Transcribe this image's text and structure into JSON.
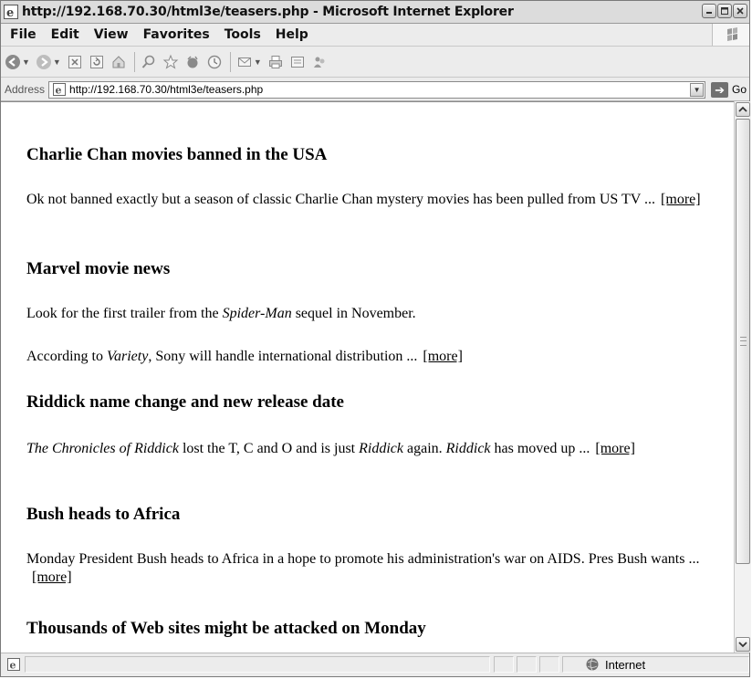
{
  "window": {
    "title": "http://192.168.70.30/html3e/teasers.php - Microsoft Internet Explorer"
  },
  "menubar": {
    "items": [
      "File",
      "Edit",
      "View",
      "Favorites",
      "Tools",
      "Help"
    ]
  },
  "toolbar": {
    "buttons": [
      "back-icon",
      "forward-icon",
      "stop-icon",
      "refresh-icon",
      "home-icon",
      "search-icon",
      "favorites-icon",
      "media-icon",
      "history-icon",
      "mail-icon",
      "print-icon",
      "edit-icon",
      "messenger-icon"
    ]
  },
  "addressbar": {
    "label": "Address",
    "url": "http://192.168.70.30/html3e/teasers.php",
    "go_label": "Go"
  },
  "articles": [
    {
      "headline": "Charlie Chan movies banned in the USA",
      "body_1": "Ok not banned exactly but a season of classic Charlie Chan mystery movies has been pulled from US TV ...",
      "more": "[more]"
    },
    {
      "headline": "Marvel movie news",
      "para1_a": "Look for the first trailer from the ",
      "para1_em": "Spider-Man",
      "para1_b": " sequel in November.",
      "para2_a": "According to ",
      "para2_em": "Variety",
      "para2_b": ", Sony will handle international distribution ...",
      "more": "[more]"
    },
    {
      "headline": "Riddick name change and new release date",
      "em1": "The Chronicles of Riddick",
      "t1": " lost the T, C and O and is just ",
      "em2": "Riddick",
      "t2": " again. ",
      "em3": "Riddick",
      "t3": " has moved up ...",
      "more": "[more]"
    },
    {
      "headline": "Bush heads to Africa",
      "body_1": "Monday President Bush heads to Africa in a hope to promote his administration's war on AIDS. Pres Bush wants ...",
      "more": "[more]"
    },
    {
      "headline": "Thousands of Web sites might be attacked on Monday"
    }
  ],
  "statusbar": {
    "zone": "Internet"
  },
  "colors": {
    "chrome": "#ececec",
    "content_bg": "#ffffff",
    "text": "#000000"
  }
}
